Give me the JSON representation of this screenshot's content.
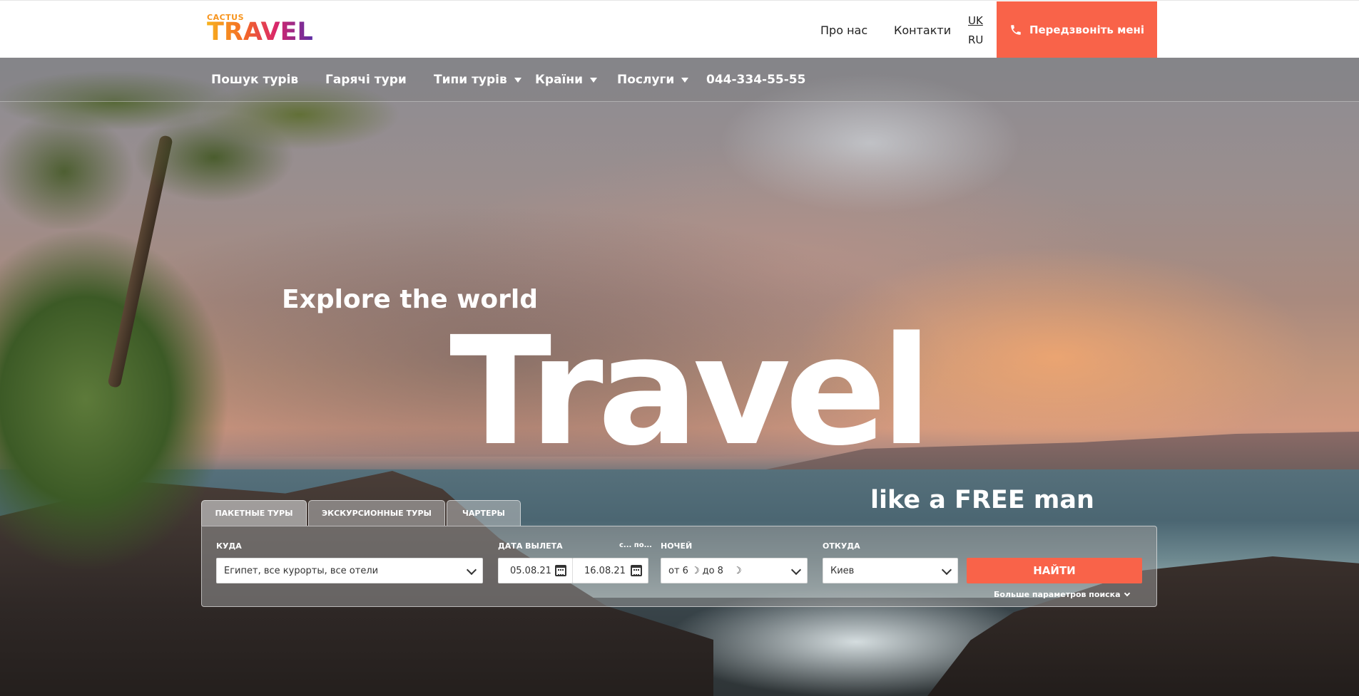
{
  "logo": {
    "small": "CACTUS",
    "big": "TRAVEL"
  },
  "header": {
    "links": [
      "Про нас",
      "Контакти"
    ],
    "languages": [
      "UK",
      "RU"
    ],
    "callback_label": "Передзвоніть мені",
    "colors": {
      "accent": "#f96349"
    }
  },
  "nav": {
    "items": [
      {
        "label": "Пошук турів"
      },
      {
        "label": "Гарячі тури"
      },
      {
        "label": "Типи турів"
      },
      {
        "label": "Країни"
      },
      {
        "label": "Послуги"
      },
      {
        "label": "044-334-55-55"
      }
    ]
  },
  "hero": {
    "subtitle": "Explore the world",
    "title": "Travel",
    "tagline": "like a FREE man"
  },
  "search": {
    "tabs": [
      "ПАКЕТНЫЕ ТУРЫ",
      "ЭКСКУРСИОННЫЕ ТУРЫ",
      "ЧАРТЕРЫ"
    ],
    "destination_label": "КУДА",
    "destination_value": "Египет, все курорты, все отели",
    "date_label": "ДАТА ВЫЛЕТА",
    "date_range_hint": "с... по...",
    "date_from": "05.08.21",
    "date_to": "16.08.21",
    "nights_label": "НОЧЕЙ",
    "nights_from": "от 6",
    "nights_to": "до 8",
    "from_label": "ОТКУДА",
    "from_value": "Киев",
    "find_label": "НАЙТИ",
    "more_params_label": "Больше параметров поиска"
  }
}
